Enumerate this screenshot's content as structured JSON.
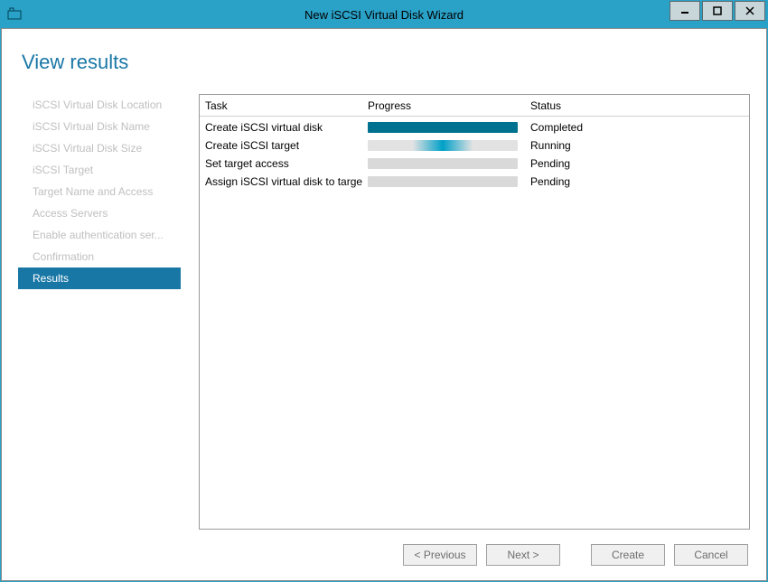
{
  "window": {
    "title": "New iSCSI Virtual Disk Wizard"
  },
  "heading": "View results",
  "sidebar": {
    "items": [
      {
        "label": "iSCSI Virtual Disk Location",
        "active": false
      },
      {
        "label": "iSCSI Virtual Disk Name",
        "active": false
      },
      {
        "label": "iSCSI Virtual Disk Size",
        "active": false
      },
      {
        "label": "iSCSI Target",
        "active": false
      },
      {
        "label": "Target Name and Access",
        "active": false
      },
      {
        "label": "Access Servers",
        "active": false
      },
      {
        "label": "Enable authentication ser...",
        "active": false
      },
      {
        "label": "Confirmation",
        "active": false
      },
      {
        "label": "Results",
        "active": true
      }
    ]
  },
  "table": {
    "headers": {
      "task": "Task",
      "progress": "Progress",
      "status": "Status"
    },
    "rows": [
      {
        "task": "Create iSCSI virtual disk",
        "progress_type": "full",
        "progress_pct": 100,
        "status": "Completed"
      },
      {
        "task": "Create iSCSI target",
        "progress_type": "indeterminate",
        "progress_pct": 0,
        "status": "Running"
      },
      {
        "task": "Set target access",
        "progress_type": "empty",
        "progress_pct": 0,
        "status": "Pending"
      },
      {
        "task": "Assign iSCSI virtual disk to target",
        "progress_type": "empty",
        "progress_pct": 0,
        "status": "Pending"
      }
    ]
  },
  "buttons": {
    "previous": "< Previous",
    "next": "Next >",
    "create": "Create",
    "cancel": "Cancel"
  }
}
